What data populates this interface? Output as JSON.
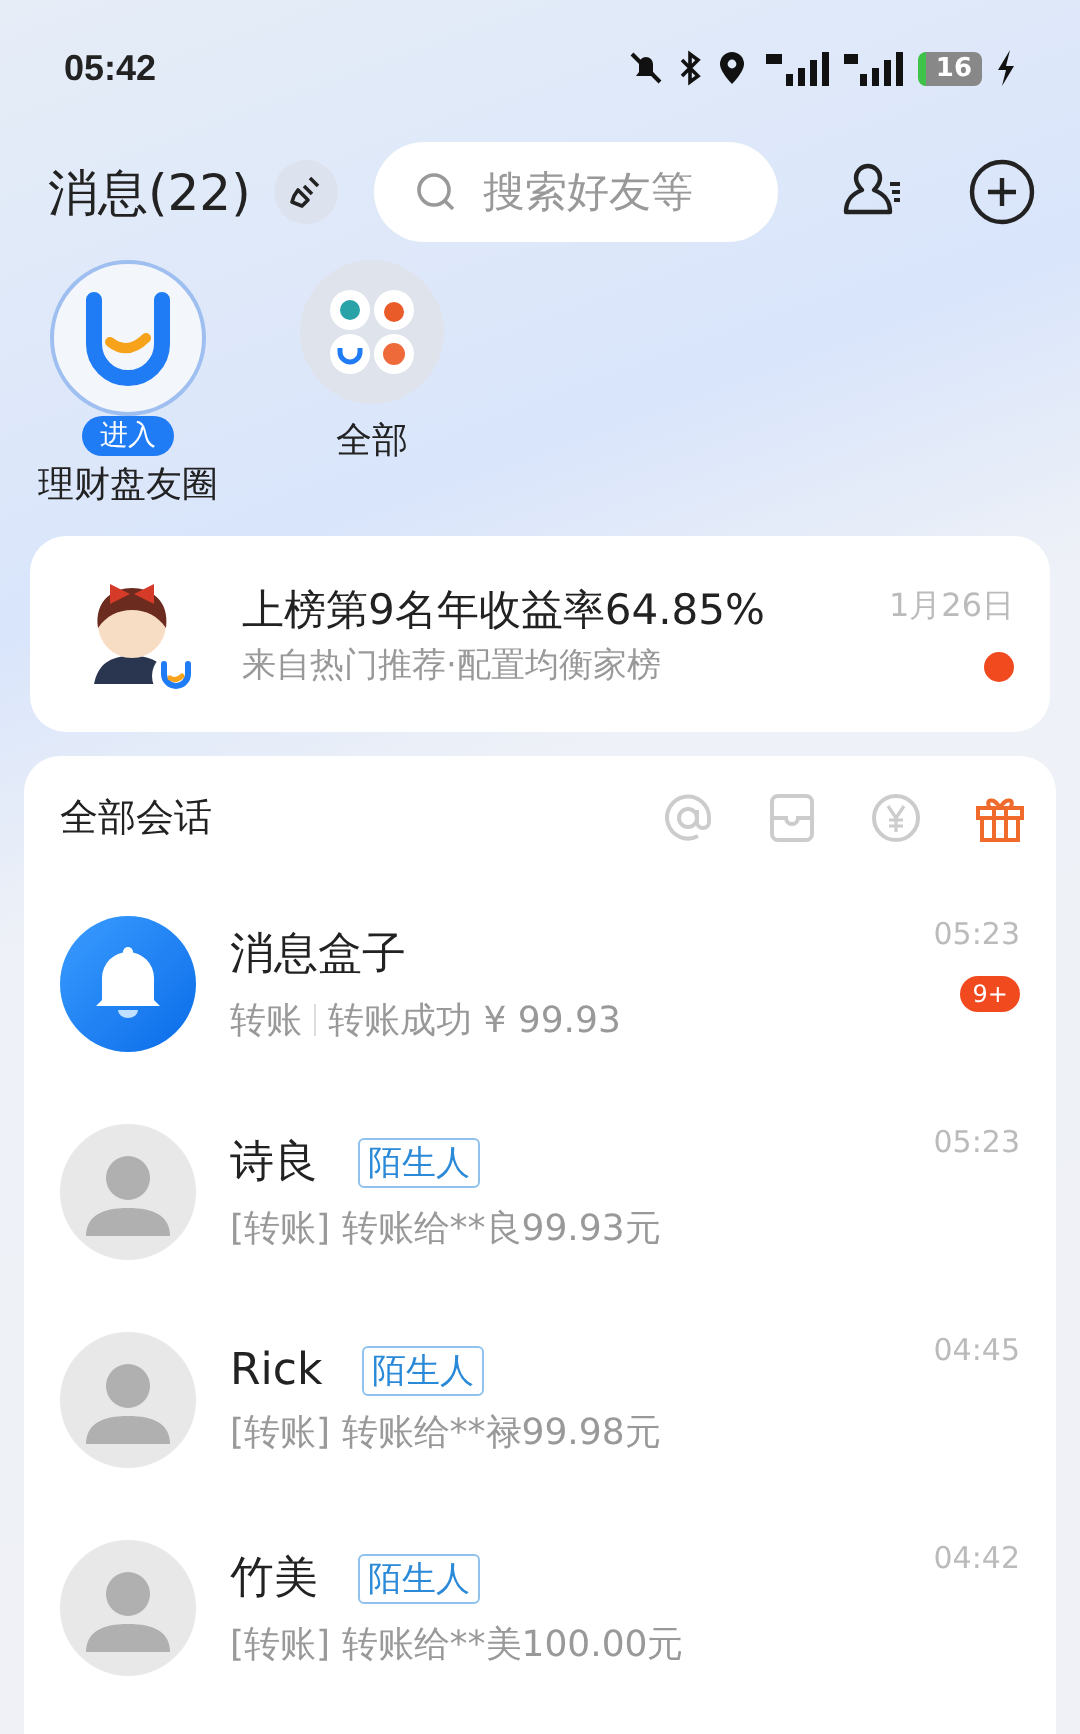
{
  "status_bar": {
    "time": "05:42",
    "battery": "16"
  },
  "header": {
    "title": "消息(22)",
    "search": {
      "placeholder": "搜索好友等"
    }
  },
  "circles": [
    {
      "label": "理财盘友圈",
      "badge": "进入",
      "selected": true
    },
    {
      "label": "全部",
      "selected": false
    }
  ],
  "featured": {
    "title": "上榜第9名年收益率64.85%",
    "subtitle": "来自热门推荐·配置均衡家榜",
    "date": "1月26日",
    "unread": true
  },
  "conversations": {
    "title": "全部会话",
    "items": [
      {
        "kind": "system",
        "name": "消息盒子",
        "preview_type": "转账",
        "preview": "转账成功 ¥ 99.93",
        "time": "05:23",
        "badge": "9+"
      },
      {
        "kind": "contact",
        "name": "诗良",
        "tag": "陌生人",
        "preview": "[转账] 转账给**良99.93元",
        "time": "05:23"
      },
      {
        "kind": "contact",
        "name": "Rick",
        "tag": "陌生人",
        "preview": "[转账] 转账给**禄99.98元",
        "time": "04:45"
      },
      {
        "kind": "contact",
        "name": "竹美",
        "tag": "陌生人",
        "preview": "[转账] 转账给**美100.00元",
        "time": "04:42"
      }
    ]
  }
}
